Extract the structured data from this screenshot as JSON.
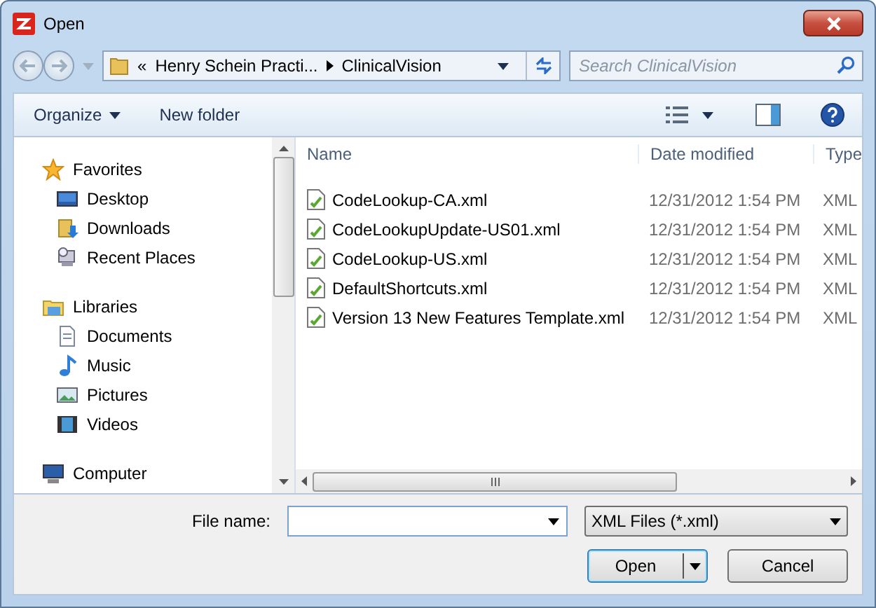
{
  "window": {
    "title": "Open"
  },
  "address": {
    "overflow": "«",
    "crumbs": [
      "Henry Schein Practi...",
      "ClinicalVision"
    ]
  },
  "search": {
    "placeholder": "Search ClinicalVision"
  },
  "toolbar": {
    "organize": "Organize",
    "new_folder": "New folder"
  },
  "nav": [
    {
      "label": "Favorites",
      "children": [
        {
          "label": "Desktop"
        },
        {
          "label": "Downloads"
        },
        {
          "label": "Recent Places"
        }
      ]
    },
    {
      "label": "Libraries",
      "children": [
        {
          "label": "Documents"
        },
        {
          "label": "Music"
        },
        {
          "label": "Pictures"
        },
        {
          "label": "Videos"
        }
      ]
    },
    {
      "label": "Computer"
    }
  ],
  "table": {
    "columns": [
      "Name",
      "Date modified",
      "Type"
    ],
    "rows": [
      {
        "name": "CodeLookup-CA.xml",
        "date": "12/31/2012 1:54 PM",
        "type": "XML"
      },
      {
        "name": "CodeLookupUpdate-US01.xml",
        "date": "12/31/2012 1:54 PM",
        "type": "XML"
      },
      {
        "name": "CodeLookup-US.xml",
        "date": "12/31/2012 1:54 PM",
        "type": "XML"
      },
      {
        "name": "DefaultShortcuts.xml",
        "date": "12/31/2012 1:54 PM",
        "type": "XML"
      },
      {
        "name": "Version 13 New Features Template.xml",
        "date": "12/31/2012 1:54 PM",
        "type": "XML"
      }
    ]
  },
  "file_name": {
    "label": "File name:"
  },
  "file_type": {
    "value": "XML Files (*.xml)"
  },
  "buttons": {
    "open": "Open",
    "cancel": "Cancel"
  }
}
